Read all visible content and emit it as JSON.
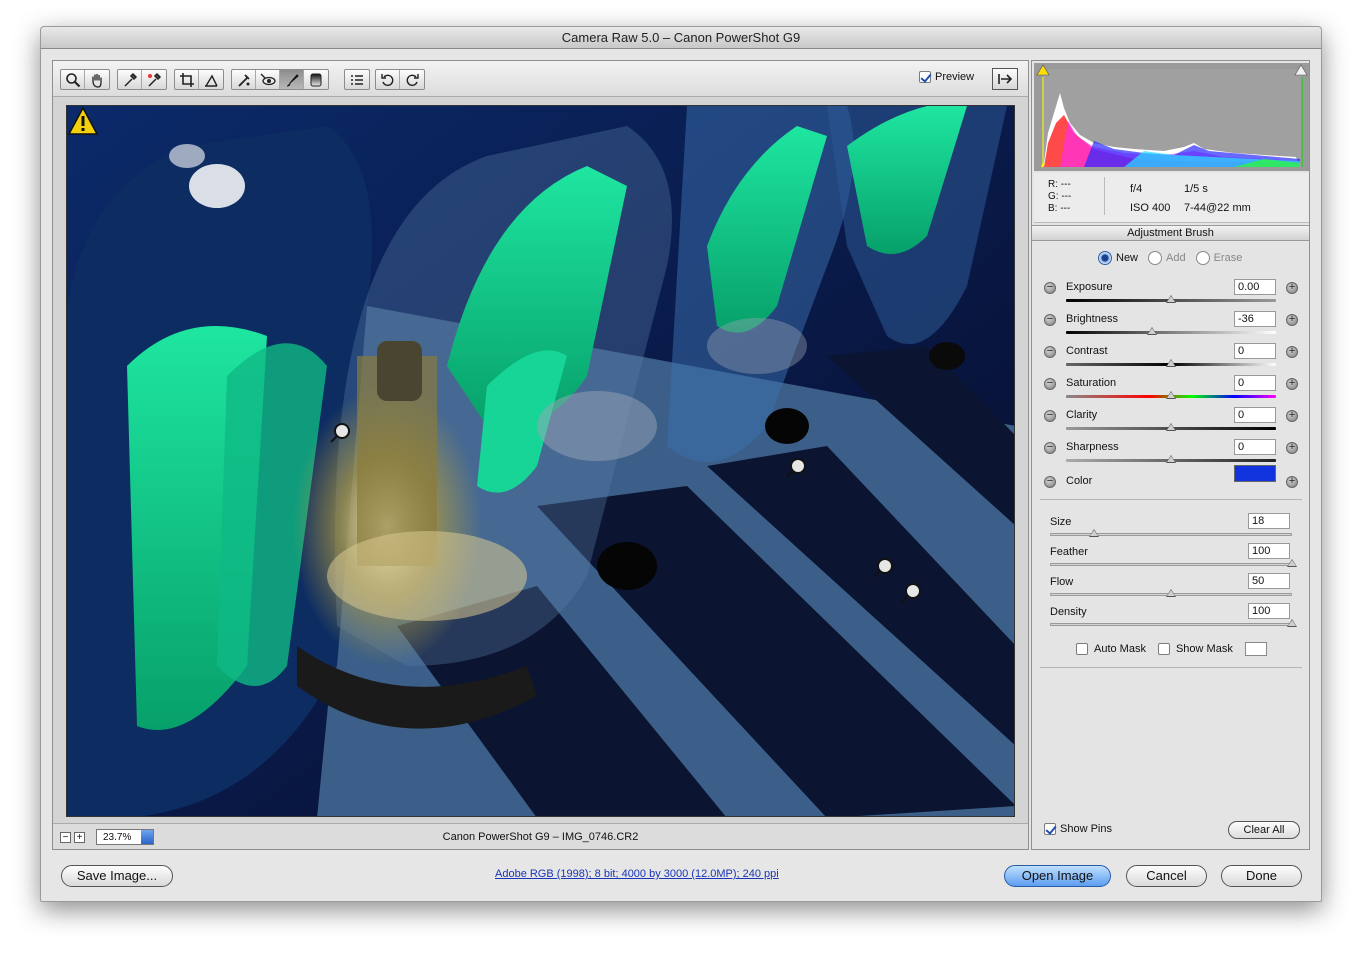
{
  "window": {
    "title": "Camera Raw 5.0  –  Canon PowerShot G9"
  },
  "toolbar": {
    "tools": [
      "zoom-icon",
      "hand-icon",
      "white-balance-icon",
      "color-sampler-icon",
      "crop-icon",
      "straighten-icon",
      "spot-removal-icon",
      "red-eye-icon",
      "adjustment-brush-icon",
      "graduated-filter-icon",
      "preferences-icon",
      "rotate-ccw-icon",
      "rotate-cw-icon"
    ],
    "preview_label": "Preview",
    "preview_checked": true
  },
  "status": {
    "zoom": "23.7%",
    "filename": "Canon PowerShot G9  –  IMG_0746.CR2"
  },
  "info": {
    "r": "R:  ---",
    "g": "G:  ---",
    "b": "B:  ---",
    "aperture": "f/4",
    "shutter": "1/5 s",
    "iso": "ISO 400",
    "lens": "7-44@22 mm"
  },
  "panel": {
    "title": "Adjustment Brush",
    "modes": [
      "New",
      "Add",
      "Erase"
    ],
    "adjustments": [
      {
        "label": "Exposure",
        "value": "0.00",
        "pos": 0.5
      },
      {
        "label": "Brightness",
        "value": "-36",
        "pos": 0.41
      },
      {
        "label": "Contrast",
        "value": "0",
        "pos": 0.5
      },
      {
        "label": "Saturation",
        "value": "0",
        "pos": 0.5
      },
      {
        "label": "Clarity",
        "value": "0",
        "pos": 0.5
      },
      {
        "label": "Sharpness",
        "value": "0",
        "pos": 0.5
      }
    ],
    "color_label": "Color",
    "color_value": "#1133dd",
    "brush": [
      {
        "label": "Size",
        "value": "18",
        "pos": 0.18
      },
      {
        "label": "Feather",
        "value": "100",
        "pos": 1.0
      },
      {
        "label": "Flow",
        "value": "50",
        "pos": 0.5
      },
      {
        "label": "Density",
        "value": "100",
        "pos": 1.0
      }
    ],
    "auto_mask": "Auto Mask",
    "show_mask": "Show Mask",
    "show_pins": "Show Pins",
    "clear_all": "Clear All"
  },
  "footer": {
    "save": "Save Image...",
    "file_info": "Adobe RGB (1998); 8 bit; 4000 by 3000 (12.0MP); 240 ppi",
    "open": "Open Image",
    "cancel": "Cancel",
    "done": "Done"
  }
}
